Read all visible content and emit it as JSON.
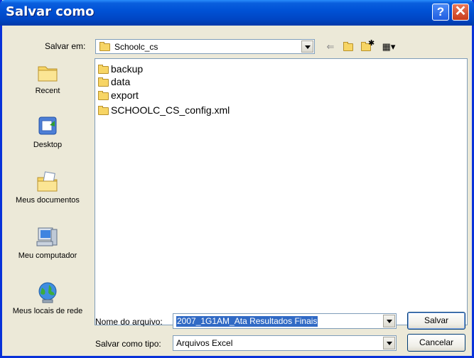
{
  "window": {
    "title": "Salvar como"
  },
  "toolbar": {
    "save_in_label": "Salvar em:",
    "save_in_value": "Schoolc_cs",
    "icons": [
      "back-arrow-icon",
      "up-folder-icon",
      "new-folder-icon",
      "view-menu-icon"
    ]
  },
  "places": [
    {
      "label": "Recent",
      "icon": "recent-icon"
    },
    {
      "label": "Desktop",
      "icon": "desktop-icon"
    },
    {
      "label": "Meus documentos",
      "icon": "my-documents-icon"
    },
    {
      "label": "Meu computador",
      "icon": "my-computer-icon"
    },
    {
      "label": "Meus locais de rede",
      "icon": "network-places-icon"
    }
  ],
  "files": [
    {
      "name": "backup",
      "type": "folder"
    },
    {
      "name": "data",
      "type": "folder"
    },
    {
      "name": "export",
      "type": "folder"
    },
    {
      "name": "SCHOOLC_CS_config.xml",
      "type": "folder"
    }
  ],
  "form": {
    "filename_label": "Nome do arquivo:",
    "filename_value": "2007_1G1AM_Ata Resultados Finais",
    "filetype_label": "Salvar como tipo:",
    "filetype_value": "Arquivos Excel"
  },
  "buttons": {
    "save": "Salvar",
    "cancel": "Cancelar"
  },
  "colors": {
    "titlebar": "#0052d6",
    "dialog_bg": "#ece9d8",
    "selection": "#316ac5"
  }
}
